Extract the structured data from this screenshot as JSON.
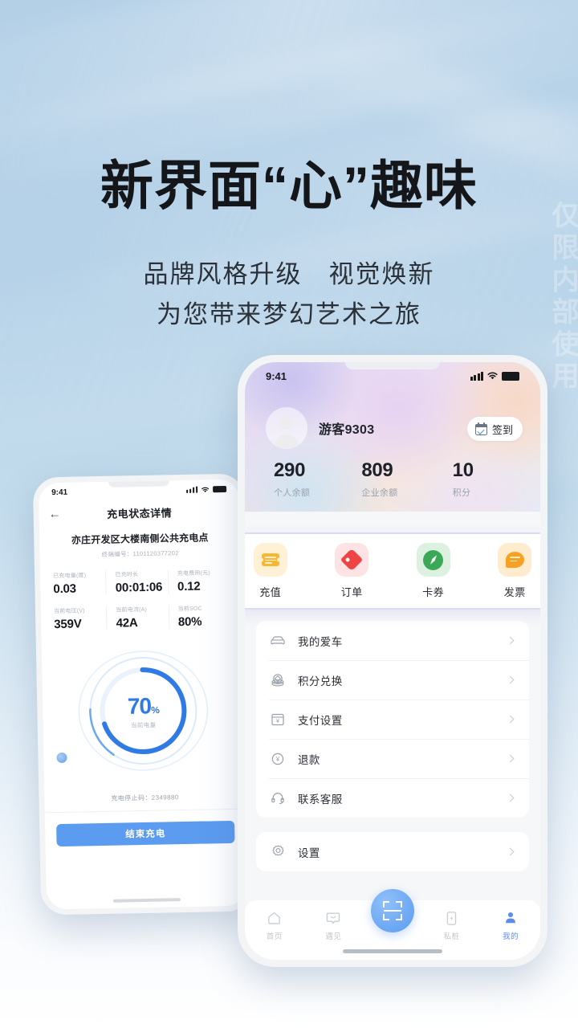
{
  "promo": {
    "headline": "新界面“心”趣味",
    "subline_1": "品牌风格升级　视觉焕新",
    "subline_2": "为您带来梦幻艺术之旅",
    "watermark": "仅限内部使用"
  },
  "colors": {
    "background_blue": "#b6d2e8",
    "accent_blue": "#5b9bf0",
    "gauge_blue": "#2f7ae5",
    "recharge_orange": "#f7b731",
    "order_red": "#ef4444",
    "card_green": "#3aa856",
    "invoice_orange": "#f7a022"
  },
  "left_phone": {
    "status_bar": {
      "time": "9:41",
      "signal_icon": "signal-bars-icon",
      "wifi_icon": "wifi-icon",
      "battery_icon": "battery-icon"
    },
    "nav": {
      "back_icon": "back-arrow-icon",
      "title": "充电状态详情"
    },
    "station": {
      "name": "亦庄开发区大楼南侧公共充电点",
      "terminal_label": "终端编号：",
      "terminal_no": "1101120377202"
    },
    "stats": [
      {
        "label": "已充电量(度)",
        "value": "0.03"
      },
      {
        "label": "已充时长",
        "value": "00:01:06"
      },
      {
        "label": "充电费用(元)",
        "value": "0.12"
      },
      {
        "label": "当前电压(V)",
        "value": "359V"
      },
      {
        "label": "当前电流(A)",
        "value": "42A"
      },
      {
        "label": "当前SOC",
        "value": "80%"
      }
    ],
    "gauge": {
      "percent": 70,
      "percent_text": "70",
      "percent_unit": "%",
      "caption": "当前电量"
    },
    "stop_code_label": "充电停止码：",
    "stop_code_value": "2349880",
    "primary_button": "结束充电"
  },
  "right_phone": {
    "status_bar": {
      "time": "9:41",
      "signal_icon": "signal-bars-icon",
      "wifi_icon": "wifi-icon",
      "battery_icon": "battery-icon"
    },
    "profile": {
      "avatar_icon": "avatar-placeholder-icon",
      "username": "游客9303"
    },
    "checkin": {
      "icon": "calendar-check-icon",
      "label": "签到"
    },
    "stats": [
      {
        "value": "290",
        "caption": "个人余额"
      },
      {
        "value": "809",
        "caption": "企业余额"
      },
      {
        "value": "10",
        "caption": "积分"
      }
    ],
    "quick_actions": [
      {
        "icon": "ticket-icon",
        "label": "充值"
      },
      {
        "icon": "tag-icon",
        "label": "订单"
      },
      {
        "icon": "compass-icon",
        "label": "卡券"
      },
      {
        "icon": "invoice-bubble-icon",
        "label": "发票"
      }
    ],
    "menu": [
      {
        "icon": "car-icon",
        "label": "我的爱车"
      },
      {
        "icon": "points-coin-icon",
        "label": "积分兑换"
      },
      {
        "icon": "payment-icon",
        "label": "支付设置"
      },
      {
        "icon": "refund-icon",
        "label": "退款"
      },
      {
        "icon": "headset-icon",
        "label": "联系客服"
      }
    ],
    "settings": {
      "icon": "gear-icon",
      "label": "设置"
    },
    "tabbar": [
      {
        "icon": "home-icon",
        "label": "首页",
        "active": false
      },
      {
        "icon": "chat-icon",
        "label": "遇见",
        "active": false
      },
      {
        "icon": "pile-icon",
        "label": "私桩",
        "active": false
      },
      {
        "icon": "person-icon",
        "label": "我的",
        "active": true
      }
    ],
    "scan_fab": {
      "icon": "scan-icon"
    }
  }
}
